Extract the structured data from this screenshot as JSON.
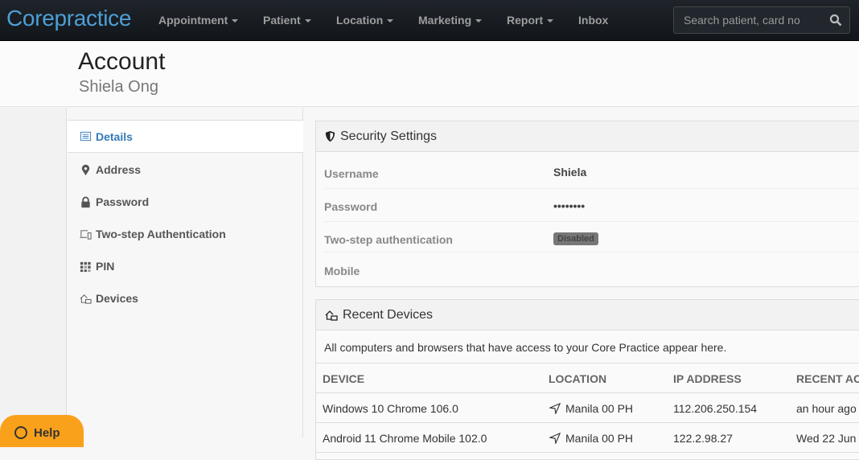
{
  "navbar": {
    "brand": "Corepractice",
    "menus": [
      "Appointment",
      "Patient",
      "Location",
      "Marketing",
      "Report"
    ],
    "inbox": "Inbox",
    "search_placeholder": "Search patient, card no"
  },
  "header": {
    "title": "Account",
    "subtitle": "Shiela Ong"
  },
  "sidebar": {
    "items": [
      {
        "label": "Details",
        "icon": "list-icon"
      },
      {
        "label": "Address",
        "icon": "map-marker-icon"
      },
      {
        "label": "Password",
        "icon": "lock-icon"
      },
      {
        "label": "Two-step Authentication",
        "icon": "devices-icon"
      },
      {
        "label": "PIN",
        "icon": "keypad-icon"
      },
      {
        "label": "Devices",
        "icon": "home-devices-icon"
      }
    ]
  },
  "security": {
    "title": "Security Settings",
    "rows": [
      {
        "label": "Username",
        "value": "Shiela"
      },
      {
        "label": "Password",
        "value": "••••••••"
      },
      {
        "label": "Two-step authentication",
        "value": "Disabled"
      },
      {
        "label": "Mobile",
        "value": ""
      }
    ]
  },
  "devices": {
    "title": "Recent Devices",
    "description": "All computers and browsers that have access to your Core Practice appear here.",
    "columns": [
      "Device",
      "Location",
      "IP Address",
      "Recent Ac"
    ],
    "rows": [
      [
        "Windows 10 Chrome 106.0",
        "Manila 00 PH",
        "112.206.250.154",
        "an hour ago"
      ],
      [
        "Android 11 Chrome Mobile 102.0",
        "Manila 00 PH",
        "122.2.98.27",
        "Wed 22 Jun"
      ]
    ]
  },
  "help": {
    "label": "Help"
  },
  "colors": {
    "accent": "#337ab7",
    "brand": "#4d9fd6",
    "help": "#f9a11b"
  }
}
